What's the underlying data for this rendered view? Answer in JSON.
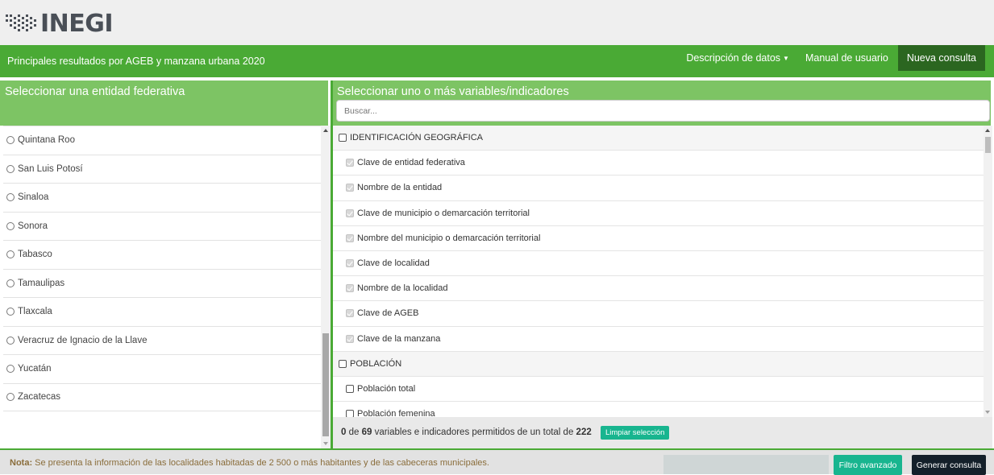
{
  "brand": {
    "logo_text": "INEGI"
  },
  "navbar": {
    "title": "Principales resultados por AGEB y manzana urbana 2020",
    "links": [
      {
        "label": "Descripción de datos",
        "has_dropdown": true
      },
      {
        "label": "Manual de usuario"
      },
      {
        "label": "Nueva consulta",
        "active": true
      }
    ]
  },
  "left_panel": {
    "title": "Seleccionar una entidad federativa",
    "states": [
      "Quintana Roo",
      "San Luis Potosí",
      "Sinaloa",
      "Sonora",
      "Tabasco",
      "Tamaulipas",
      "Tlaxcala",
      "Veracruz de Ignacio de la Llave",
      "Yucatán",
      "Zacatecas"
    ]
  },
  "right_panel": {
    "title": "Seleccionar uno o más variables/indicadores",
    "search_placeholder": "Buscar...",
    "groups": [
      {
        "label": "IDENTIFICACIÓN GEOGRÁFICA",
        "items": [
          "Clave de entidad federativa",
          "Nombre de la entidad",
          "Clave de municipio o demarcación territorial",
          "Nombre del municipio o demarcación territorial",
          "Clave de localidad",
          "Nombre de la localidad",
          "Clave de AGEB",
          "Clave de la manzana"
        ]
      },
      {
        "label": "POBLACIÓN",
        "items": [
          "Población total",
          "Población femenina"
        ]
      }
    ],
    "counter": {
      "selected": "0",
      "text1": " de ",
      "allowed": "69",
      "text2": " variables e indicadores permitidos de un total de ",
      "total": "222"
    },
    "clear_label": "Limpiar selección"
  },
  "footer": {
    "note_label": "Nota:",
    "note_text": " Se presenta la información de las localidades habitadas de 2 500 o más habitantes y de las cabeceras municipales.",
    "filter_label": "Filtro avanzado",
    "generate_label": "Generar consulta"
  },
  "colors": {
    "primary_green": "#4aaa35",
    "light_green": "#7dc464",
    "dark_green": "#2b6620",
    "teal": "#18b58f",
    "dark": "#14202a"
  },
  "icons": {
    "left_item": "radio-button",
    "group": "checkbox",
    "item": "checkbox"
  }
}
